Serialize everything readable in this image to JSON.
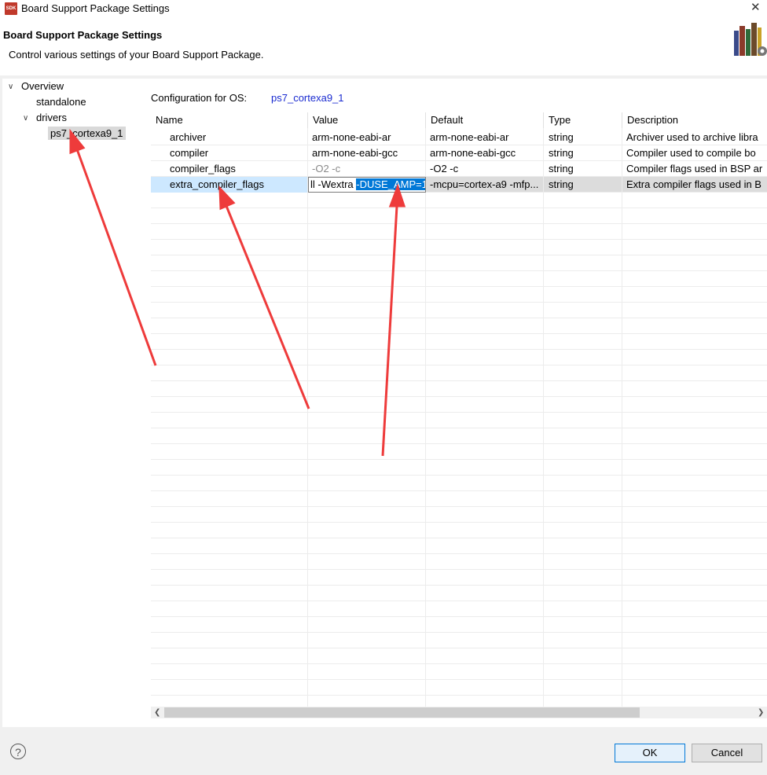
{
  "window": {
    "title": "Board Support Package Settings",
    "app_badge": "SDK"
  },
  "header": {
    "title": "Board Support Package Settings",
    "subtitle": "Control various settings of your Board Support Package."
  },
  "tree": {
    "overview": "Overview",
    "standalone": "standalone",
    "drivers": "drivers",
    "cpu": "ps7_cortexa9_1"
  },
  "config": {
    "label": "Configuration for OS:",
    "value": "ps7_cortexa9_1"
  },
  "table": {
    "headers": [
      "Name",
      "Value",
      "Default",
      "Type",
      "Description"
    ],
    "rows": [
      {
        "name": "archiver",
        "value": "arm-none-eabi-ar",
        "default": "arm-none-eabi-ar",
        "type": "string",
        "description": "Archiver used to archive libra"
      },
      {
        "name": "compiler",
        "value": "arm-none-eabi-gcc",
        "default": "arm-none-eabi-gcc",
        "type": "string",
        "description": "Compiler used to compile bo"
      },
      {
        "name": "compiler_flags",
        "value": "-O2 -c",
        "default": "-O2 -c",
        "type": "string",
        "description": "Compiler flags used in BSP ar"
      },
      {
        "name": "extra_compiler_flags",
        "value_prefix": "ll -Wextra ",
        "value_selected": "-DUSE_AMP=1",
        "default": "-mcpu=cortex-a9 -mfp...",
        "type": "string",
        "description": "Extra compiler flags used in B"
      }
    ]
  },
  "buttons": {
    "help": "?",
    "ok": "OK",
    "cancel": "Cancel"
  },
  "colors": {
    "link": "#1a2bd0",
    "selection": "#0078d7",
    "annotation_arrow": "#ee3b3b"
  }
}
